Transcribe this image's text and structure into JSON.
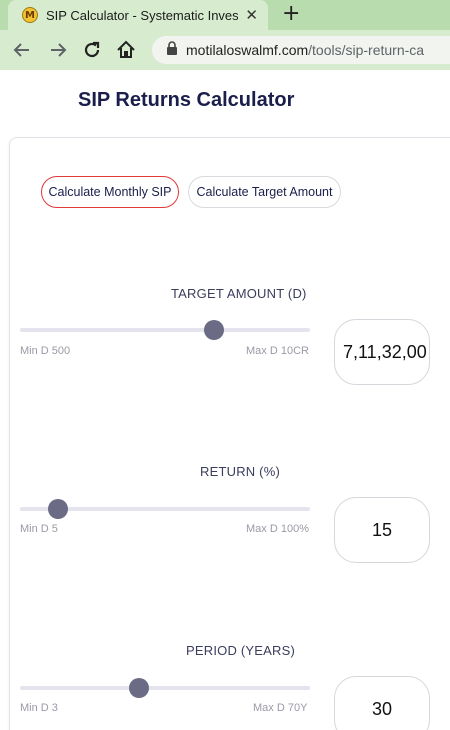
{
  "browser": {
    "tab_title": "SIP Calculator - Systematic Invest",
    "favicon_letter": "M",
    "url_host": "motilaloswalmf.com",
    "url_path": "/tools/sip-return-ca"
  },
  "page": {
    "title": "SIP Returns Calculator",
    "modes": [
      "Calculate Monthly SIP",
      "Calculate Target Amount"
    ],
    "active_mode": "Calculate Monthly SIP"
  },
  "fields": [
    {
      "label": "TARGET AMOUNT (D)",
      "min_label": "Min D 500",
      "max_label": "Max D 10CR",
      "value": "7,11,32,00",
      "slider_fraction": 0.67
    },
    {
      "label": "RETURN (%)",
      "min_label": "Min D 5",
      "max_label": "Max D 100%",
      "value": "15",
      "slider_fraction": 0.13
    },
    {
      "label": "PERIOD (YEARS)",
      "min_label": "Min D 3",
      "max_label": "Max D 70Y",
      "value": "30",
      "slider_fraction": 0.41
    }
  ],
  "colors": {
    "accent_red": "#e03a3a",
    "title_navy": "#1b1e4b",
    "thumb": "#6b6b86",
    "browser_green": "#d7eccf"
  }
}
